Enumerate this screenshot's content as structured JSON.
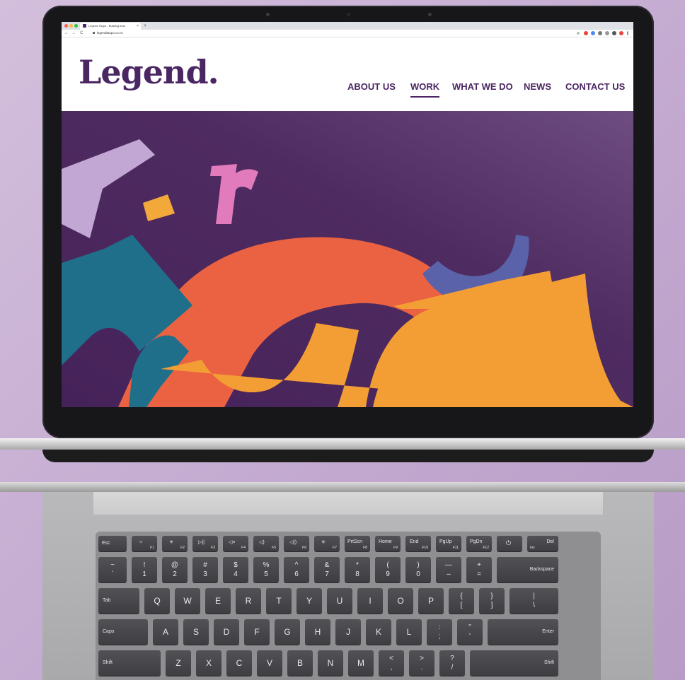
{
  "browser": {
    "tab_title": "Legend Taupo - Building bran",
    "tab_close": "×",
    "new_tab": "+",
    "back": "←",
    "forward": "→",
    "reload": "C",
    "url": "legendtaupo.co.nz"
  },
  "site": {
    "logo": "Legend.",
    "nav": [
      "ABOUT US",
      "WORK",
      "WHAT WE DO",
      "NEWS",
      "CONTACT US"
    ],
    "active_nav": "WORK",
    "brand_color": "#4a2663"
  },
  "hero": {
    "background": "#4e2a5f",
    "shape_colors": {
      "lilac": "#c2a6d3",
      "yellow": "#f3a93a",
      "pink": "#e27bbb",
      "orange": "#ea6241",
      "teal": "#1f6f8b",
      "indigo": "#5a62a9",
      "amber": "#f39e34"
    }
  },
  "keyboard": {
    "fn_row": [
      {
        "main": "Esc",
        "fn": ""
      },
      {
        "main": "☼",
        "fn": "F1"
      },
      {
        "main": "☀",
        "fn": "F2"
      },
      {
        "main": "▷||",
        "fn": "F3"
      },
      {
        "main": "◁×",
        "fn": "F4"
      },
      {
        "main": "◁)",
        "fn": "F5"
      },
      {
        "main": "◁))",
        "fn": "F6"
      },
      {
        "main": "✳",
        "fn": "F7"
      },
      {
        "main": "PrtScn",
        "fn": "F8"
      },
      {
        "main": "Home",
        "fn": "F9"
      },
      {
        "main": "End",
        "fn": "F10"
      },
      {
        "main": "PgUp",
        "fn": "F11"
      },
      {
        "main": "PgDn",
        "fn": "F12"
      },
      {
        "main": "⏻",
        "fn": ""
      },
      {
        "main": "Del",
        "fn": "Ins"
      }
    ],
    "num_row": [
      {
        "top": "~",
        "bot": "`"
      },
      {
        "top": "!",
        "bot": "1"
      },
      {
        "top": "@",
        "bot": "2"
      },
      {
        "top": "#",
        "bot": "3"
      },
      {
        "top": "$",
        "bot": "4"
      },
      {
        "top": "%",
        "bot": "5"
      },
      {
        "top": "^",
        "bot": "6"
      },
      {
        "top": "&",
        "bot": "7"
      },
      {
        "top": "*",
        "bot": "8"
      },
      {
        "top": "(",
        "bot": "9"
      },
      {
        "top": ")",
        "bot": "0"
      },
      {
        "top": "—",
        "bot": "–"
      },
      {
        "top": "+",
        "bot": "="
      }
    ],
    "backspace": "Backspace",
    "tab": "Tab",
    "row_q": [
      "Q",
      "W",
      "E",
      "R",
      "T",
      "Y",
      "U",
      "I",
      "O",
      "P"
    ],
    "bracket_open": {
      "top": "{",
      "bot": "["
    },
    "bracket_close": {
      "top": "}",
      "bot": "]"
    },
    "pipe": {
      "top": "|",
      "bot": "\\"
    },
    "caps": "Caps",
    "row_a": [
      "A",
      "S",
      "D",
      "F",
      "G",
      "H",
      "J",
      "K",
      "L"
    ],
    "colon": {
      "top": ":",
      "bot": ";"
    },
    "quote": {
      "top": "\"",
      "bot": "'"
    },
    "enter": "Enter",
    "shift_left": "Shift",
    "row_z": [
      "Z",
      "X",
      "C",
      "V",
      "B",
      "N",
      "M"
    ],
    "lt": {
      "top": "<",
      "bot": ","
    },
    "gt": {
      "top": ">",
      "bot": "."
    },
    "question": {
      "top": "?",
      "bot": "/"
    },
    "shift_right": "Shift"
  }
}
